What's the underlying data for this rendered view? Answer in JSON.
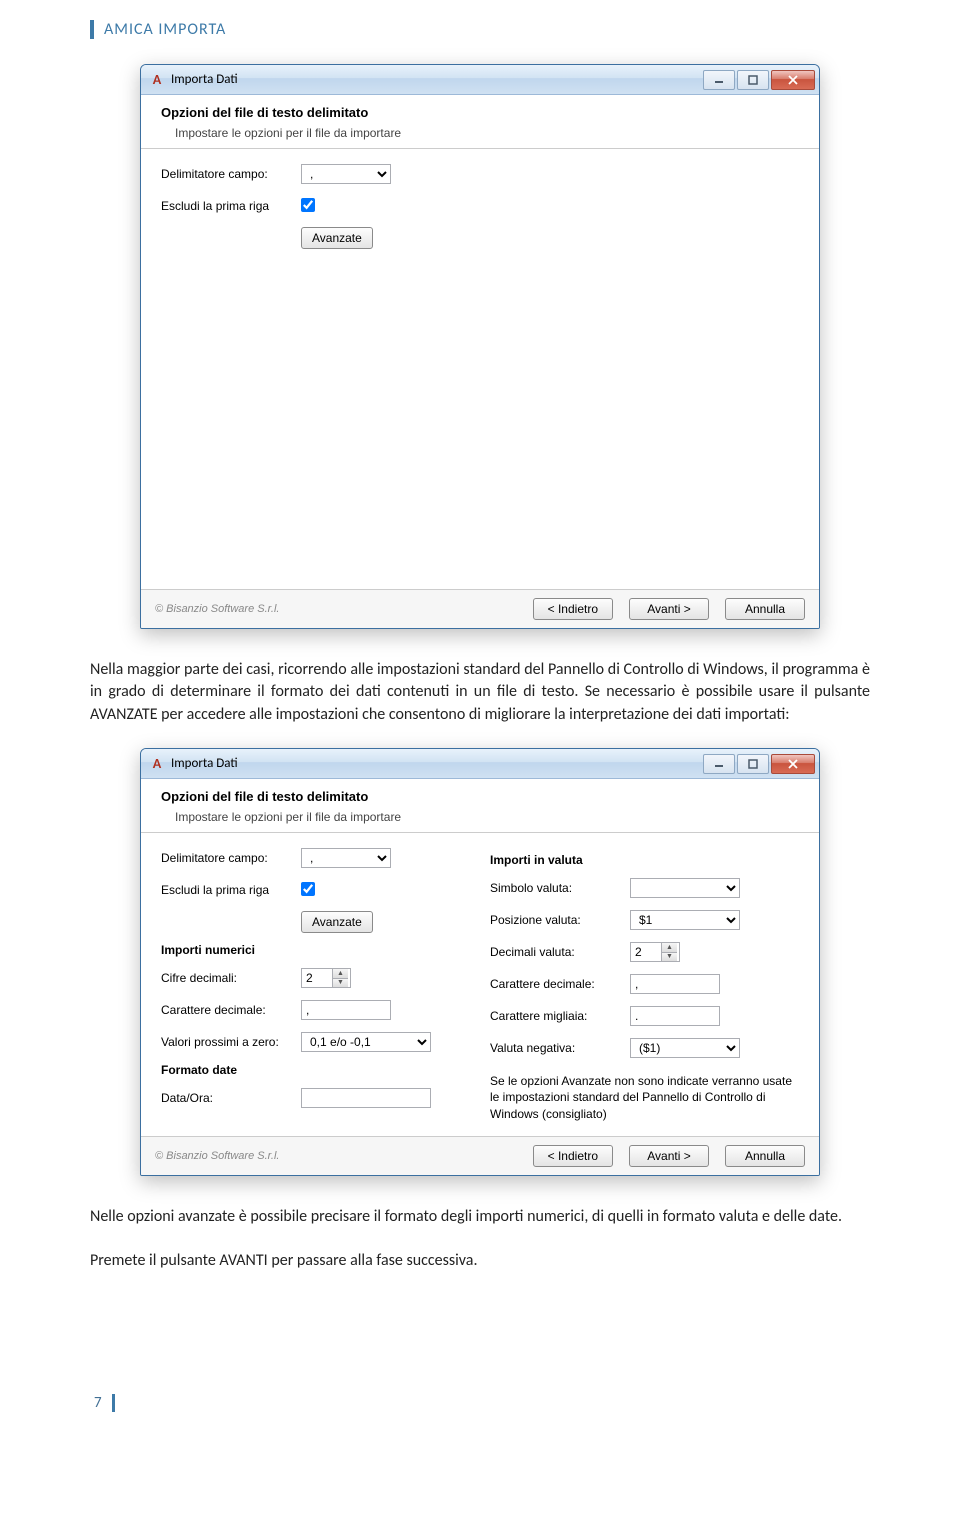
{
  "doc_header": "AMICA IMPORTA",
  "page_number": "7",
  "dialog": {
    "title": "Importa Dati",
    "section_title": "Opzioni del file di testo delimitato",
    "section_sub": "Impostare le opzioni per il file da importare",
    "copyright": "© Bisanzio Software S.r.l.",
    "btn_back": "< Indietro",
    "btn_next": "Avanti >",
    "btn_cancel": "Annulla",
    "btn_advanced": "Avanzate",
    "labels": {
      "delim": "Delimitatore campo:",
      "exclude": "Escludi la prima riga",
      "num_group": "Importi numerici",
      "decimals": "Cifre decimali:",
      "dec_char": "Carattere decimale:",
      "near_zero": "Valori prossimi a zero:",
      "date_group": "Formato date",
      "date_time": "Data/Ora:",
      "curr_group": "Importi in valuta",
      "curr_symbol": "Simbolo valuta:",
      "curr_pos": "Posizione valuta:",
      "curr_dec": "Decimali valuta:",
      "curr_dec_char": "Carattere decimale:",
      "curr_thou": "Carattere migliaia:",
      "curr_neg": "Valuta negativa:"
    },
    "values": {
      "delim": ",",
      "exclude_checked": true,
      "decimals": "2",
      "dec_char": ",",
      "near_zero": "0,1 e/o -0,1",
      "date_time": "",
      "curr_symbol": "",
      "curr_pos": "$1",
      "curr_dec": "2",
      "curr_dec_char": ",",
      "curr_thou": ".",
      "curr_neg": "($1)"
    },
    "advanced_note": "Se le opzioni Avanzate non sono indicate verranno usate le impostazioni standard del Pannello di Controllo di Windows (consigliato)"
  },
  "para1": "Nella maggior parte dei casi, ricorrendo alle impostazioni standard del Pannello di Controllo di Windows, il programma è in grado di determinare il formato dei dati contenuti in un file di testo. Se necessario è possibile usare il pulsante AVANZATE per accedere alle impostazioni che consentono di migliorare la interpretazione dei dati importati:",
  "para2": "Nelle opzioni avanzate è possibile precisare il formato degli importi numerici, di quelli in formato valuta e delle date.",
  "para3": "Premete il pulsante AVANTI per passare alla fase successiva."
}
